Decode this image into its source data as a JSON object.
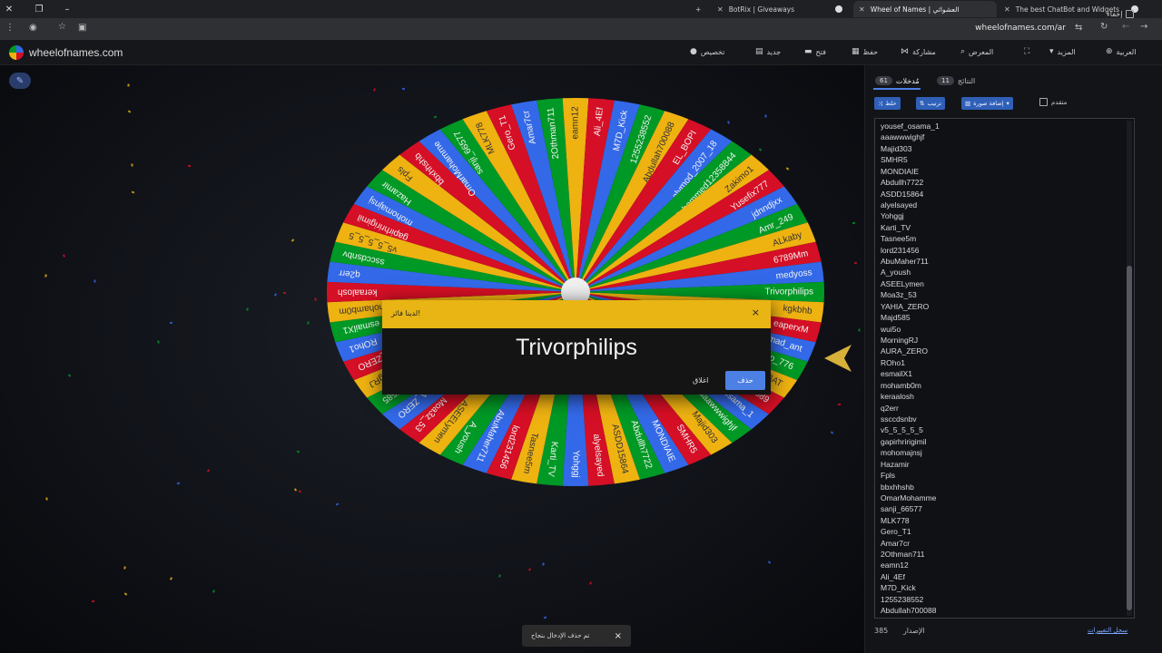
{
  "browser": {
    "tabs": [
      {
        "title": "BotRix | Giveaways",
        "active": false
      },
      {
        "title": "Wheel of Names | العشوائي",
        "active": true
      },
      {
        "title": "The best ChatBot and Widgets",
        "active": false
      }
    ],
    "new_tab_symbol": "+",
    "url": "wheelofnames.com/ar"
  },
  "site": {
    "logo_text": "wheelofnames.com",
    "nav": {
      "customize": "تخصيص",
      "new": "جديد",
      "open": "فتح",
      "save": "حفظ",
      "share": "مشاركة",
      "gallery": "المعرض",
      "more": "المزيد",
      "language": "العربية"
    }
  },
  "wheel": {
    "colors": [
      "#3369e8",
      "#009925",
      "#eeb211",
      "#d50f25"
    ],
    "pointer_color": "#d8b13a",
    "segments": [
      "yousef_osama_1",
      "aaawwwighjf",
      "Majid303",
      "SMHR5",
      "MONDIAIE",
      "Abdullh7722",
      "ASDD15864",
      "alyelsayed",
      "Yohggj",
      "Karti_TV",
      "Tasnee5m",
      "lord231456",
      "AbuMaher711",
      "A_yoush",
      "ASEELymen",
      "Moa3z_53",
      "YAHIA_ZERO",
      "Majd585",
      "MorningRJ",
      "AURA_ZERO",
      "ROho1",
      "esmailX1",
      "mohamb0m",
      "keraalosh",
      "q2err",
      "ssccdsnbv",
      "v5_5_5_5_5",
      "gapirhririgimil",
      "mohomajnsj",
      "Hazamir",
      "Fpls",
      "bbxhhshb",
      "OmarMohamme",
      "sanji_66577",
      "MLK778",
      "Gero_T1",
      "Amar7cr",
      "2Othman711",
      "eamn12",
      "Ali_4Ef",
      "M7D_Kick",
      "1255238552",
      "Abdullah700088",
      "EL_BOPI",
      "alymod_2007_18",
      "Mohammed12358844",
      "Zakimo1",
      "Yusefix777",
      "jdnndjxx",
      "Amr_249",
      "ALkaby",
      "6789Mm",
      "medyoss",
      "Trivorphilips",
      "kgkbhb",
      "eaperxM",
      "Ahmad_ant",
      "zalo_776",
      "TWBAT",
      "zozo589"
    ]
  },
  "winner_dialog": {
    "title": "لدينا فائز!",
    "close_symbol": "×",
    "winner": "Trivorphilips",
    "close_label": "اغلاق",
    "remove_label": "حذف"
  },
  "snackbar": {
    "message": "تم حذف الإدخال بنجاح",
    "close_symbol": "×"
  },
  "panel": {
    "hide_label": "إخفاء",
    "entries_tab": {
      "label": "مُدخلات",
      "count": "61"
    },
    "results_tab": {
      "label": "النتائج",
      "count": "11"
    },
    "shuffle_label": "خلط",
    "sort_label": "ترتيب",
    "add_image_label": "إضافة صورة",
    "advanced_label": "متقدم",
    "entries": [
      "yousef_osama_1",
      "aaawwwighjf",
      "Majid303",
      "SMHR5",
      "MONDIAIE",
      "Abdullh7722",
      "ASDD15864",
      "alyelsayed",
      "Yohggj",
      "Karti_TV",
      "Tasnee5m",
      "lord231456",
      "AbuMaher711",
      "A_yoush",
      "ASEELymen",
      "Moa3z_53",
      "YAHIA_ZERO",
      "Majd585",
      "wui5o",
      "MorningRJ",
      "AURA_ZERO",
      "ROho1",
      "esmailX1",
      "mohamb0m",
      "keraalosh",
      "q2err",
      "ssccdsnbv",
      "v5_5_5_5_5",
      "gapirhririgimil",
      "mohomajnsj",
      "Hazamir",
      "Fpls",
      "bbxhhshb",
      "OmarMohamme",
      "sanji_66577",
      "MLK778",
      "Gero_T1",
      "Amar7cr",
      "2Othman711",
      "eamn12",
      "Ali_4Ef",
      "M7D_Kick",
      "1255238552",
      "Abdullah700088"
    ],
    "version_label": "الإصدار",
    "version_number": "385",
    "changelog_label": "سجل التغييرات"
  }
}
